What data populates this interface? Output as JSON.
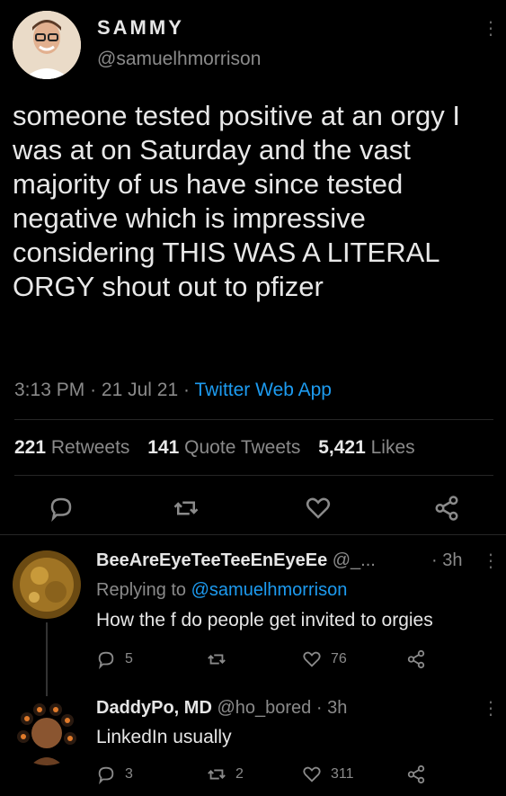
{
  "tweet": {
    "display_name": "SAMMY",
    "handle": "@samuelhmorrison",
    "text": "someone tested positive at an orgy I was at on Saturday and the vast majority of us have since tested negative which is impressive considering THIS WAS A LITERAL ORGY shout out to pfizer",
    "time": "3:13 PM",
    "date": "21 Jul 21",
    "source": "Twitter Web App",
    "separator": "·"
  },
  "stats": {
    "retweets_count": "221",
    "retweets_label": "Retweets",
    "quote_count": "141",
    "quote_label": "Quote Tweets",
    "likes_count": "5,421",
    "likes_label": "Likes"
  },
  "replies": [
    {
      "name": "BeeAreEyeTeeTeeEnEyeEe",
      "handle": "@_...",
      "time": "· 3h",
      "replying_prefix": "Replying to",
      "replying_to": "@samuelhmorrison",
      "text": "How the f do people get invited to orgies",
      "reply_count": "5",
      "retweet_count": "",
      "like_count": "76"
    },
    {
      "name": "DaddyPo, MD",
      "handle": "@ho_bored",
      "time": "· 3h",
      "text": "LinkedIn usually",
      "reply_count": "3",
      "retweet_count": "2",
      "like_count": "311"
    }
  ],
  "icons": {
    "reply": "comment-icon",
    "retweet": "retweet-icon",
    "like": "heart-icon",
    "share": "share-icon",
    "more": "more-vertical-icon"
  },
  "colors": {
    "background": "#000000",
    "link": "#1d9bf0",
    "muted": "#8a8a8a"
  }
}
